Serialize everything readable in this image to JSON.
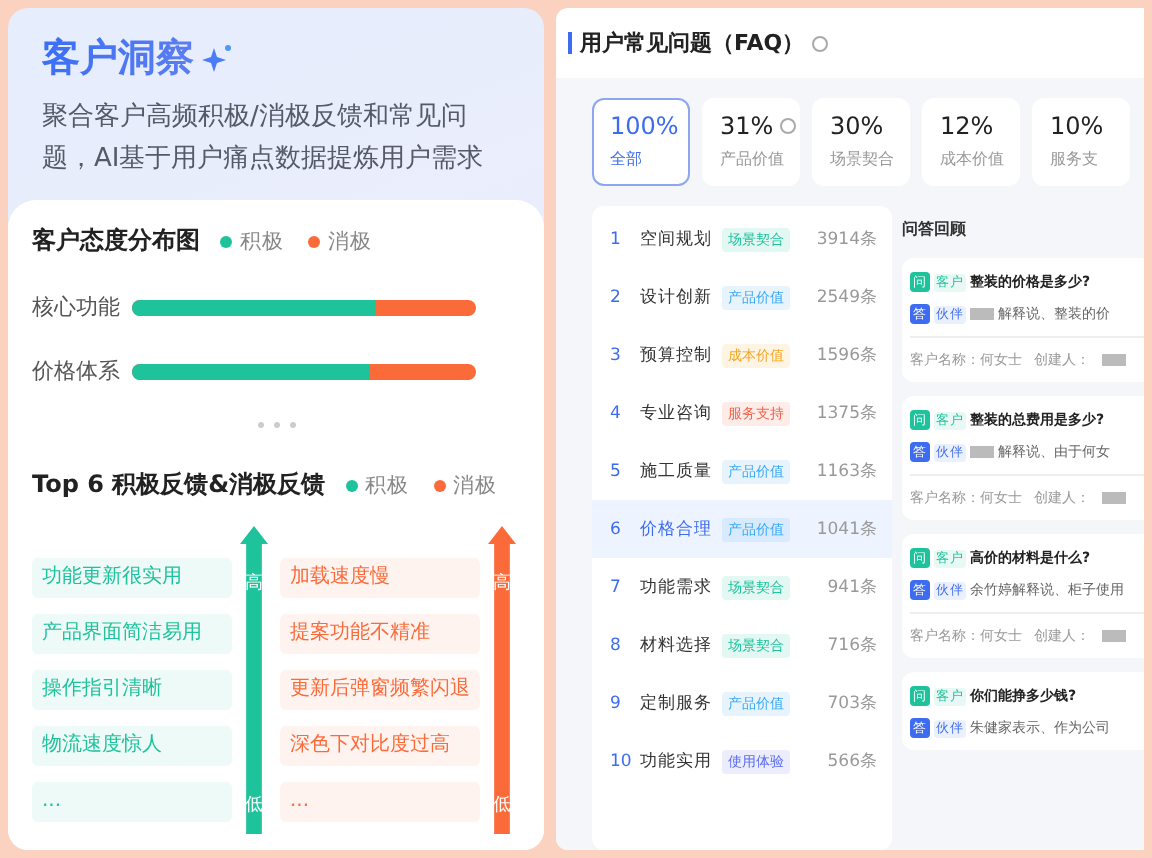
{
  "insight": {
    "title": "客户洞察",
    "description": "聚合客户高频积极/消极反馈和常见问题，AI基于用户痛点数据提炼用户需求",
    "distribution": {
      "title": "客户态度分布图",
      "legend": [
        {
          "label": "积极",
          "color": "#1fc39b"
        },
        {
          "label": "消极",
          "color": "#fb6b3a"
        }
      ],
      "rows": [
        {
          "label": "核心功能",
          "level": 0.71
        },
        {
          "label": "价格体系",
          "level": 0.69
        }
      ]
    },
    "top": {
      "title": "Top 6 积极反馈&消极反馈",
      "legend": [
        {
          "label": "积极",
          "color": "#1fc39b"
        },
        {
          "label": "消极",
          "color": "#fb6b3a"
        }
      ],
      "columns": [
        {
          "color": "#1fc39b",
          "high": "高",
          "low": "低",
          "items": [
            "功能更新很实用",
            "产品界面简洁易用",
            "操作指引清晰",
            "物流速度惊人",
            "..."
          ]
        },
        {
          "color": "#fb6b3a",
          "high": "高",
          "low": "低",
          "items": [
            "加载速度慢",
            "提案功能不精准",
            "更新后弹窗频繁闪退",
            "深色下对比度过高",
            "..."
          ]
        }
      ]
    }
  },
  "faq": {
    "title": "用户常见问题（FAQ）",
    "stats": [
      {
        "value": "100%",
        "label": "全部",
        "selected": true,
        "help": false
      },
      {
        "value": "31%",
        "label": "产品价值",
        "selected": false,
        "help": true
      },
      {
        "value": "30%",
        "label": "场景契合",
        "selected": false,
        "help": false
      },
      {
        "value": "12%",
        "label": "成本价值",
        "selected": false,
        "help": false
      },
      {
        "value": "10%",
        "label": "服务支",
        "selected": false,
        "help": false
      }
    ],
    "rows": [
      {
        "rank": "1",
        "name": "空间规划",
        "tag": "场景契合",
        "color": "#1fc39b",
        "count": "3914条",
        "selected": false
      },
      {
        "rank": "2",
        "name": "设计创新",
        "tag": "产品价值",
        "color": "#3aa8f5",
        "count": "2549条",
        "selected": false
      },
      {
        "rank": "3",
        "name": "预算控制",
        "tag": "成本价值",
        "color": "#f5a623",
        "count": "1596条",
        "selected": false
      },
      {
        "rank": "4",
        "name": "专业咨询",
        "tag": "服务支持",
        "color": "#f5634a",
        "count": "1375条",
        "selected": false
      },
      {
        "rank": "5",
        "name": "施工质量",
        "tag": "产品价值",
        "color": "#3aa8f5",
        "count": "1163条",
        "selected": false
      },
      {
        "rank": "6",
        "name": "价格合理",
        "tag": "产品价值",
        "color": "#3aa8f5",
        "count": "1041条",
        "selected": true
      },
      {
        "rank": "7",
        "name": "功能需求",
        "tag": "场景契合",
        "color": "#1fc39b",
        "count": "941条",
        "selected": false
      },
      {
        "rank": "8",
        "name": "材料选择",
        "tag": "场景契合",
        "color": "#1fc39b",
        "count": "716条",
        "selected": false
      },
      {
        "rank": "9",
        "name": "定制服务",
        "tag": "产品价值",
        "color": "#3aa8f5",
        "count": "703条",
        "selected": false
      },
      {
        "rank": "10",
        "name": "功能实用",
        "tag": "使用体验",
        "color": "#5b6cf0",
        "count": "566条",
        "selected": false
      }
    ],
    "qa": {
      "title": "问答回顾",
      "cards": [
        {
          "q_badge": "问",
          "q_role": "客户",
          "question": "整装的价格是多少?",
          "a_badge": "答",
          "a_role": "伙伴",
          "redacted": true,
          "answer": "解释说、整装的价",
          "customer": "客户名称：何女士",
          "creator": "创建人："
        },
        {
          "q_badge": "问",
          "q_role": "客户",
          "question": "整装的总费用是多少?",
          "a_badge": "答",
          "a_role": "伙伴",
          "redacted": true,
          "answer": "解释说、由于何女",
          "customer": "客户名称：何女士",
          "creator": "创建人："
        },
        {
          "q_badge": "问",
          "q_role": "客户",
          "question": "高价的材料是什么?",
          "a_badge": "答",
          "a_role": "伙伴",
          "redacted": false,
          "answer": "余竹婷解释说、柜子使用",
          "customer": "客户名称：何女士",
          "creator": "创建人："
        },
        {
          "q_badge": "问",
          "q_role": "客户",
          "question": "你们能挣多少钱?",
          "a_badge": "答",
          "a_role": "伙伴",
          "redacted": false,
          "answer": "朱健家表示、作为公司"
        }
      ]
    }
  }
}
